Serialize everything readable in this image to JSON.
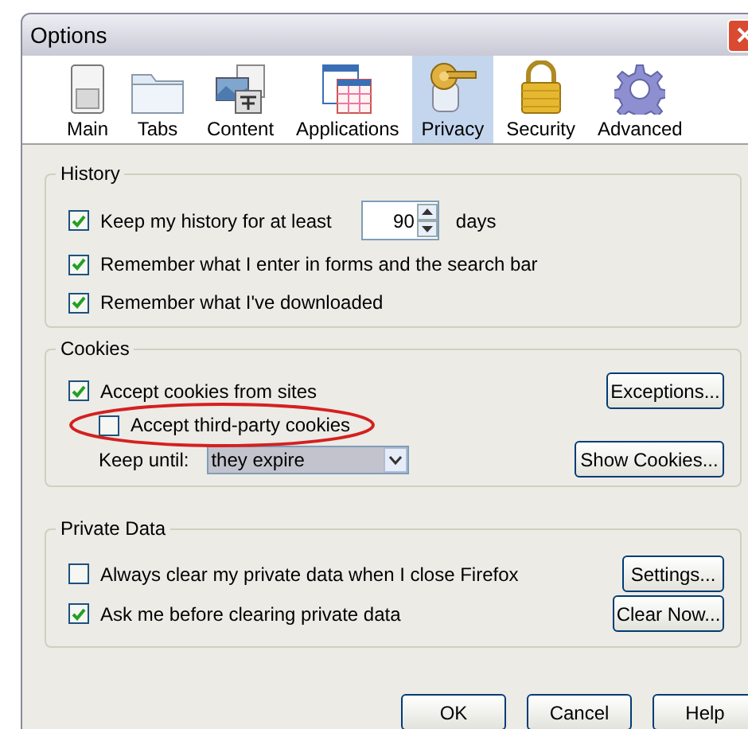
{
  "window": {
    "title": "Options"
  },
  "tabs": [
    {
      "label": "Main",
      "selected": false
    },
    {
      "label": "Tabs",
      "selected": false
    },
    {
      "label": "Content",
      "selected": false
    },
    {
      "label": "Applications",
      "selected": false
    },
    {
      "label": "Privacy",
      "selected": true
    },
    {
      "label": "Security",
      "selected": false
    },
    {
      "label": "Advanced",
      "selected": false
    }
  ],
  "history": {
    "title": "History",
    "keep_history": {
      "label": "Keep my history for at least",
      "checked": true,
      "value": "90",
      "unit": "days"
    },
    "options": [
      {
        "label": "Remember what I enter in forms and the search bar",
        "checked": true
      },
      {
        "label": "Remember what I've downloaded",
        "checked": true
      }
    ]
  },
  "cookies": {
    "title": "Cookies",
    "accept": {
      "label": "Accept cookies from sites",
      "checked": true
    },
    "exceptions_button": "Exceptions...",
    "third_party": {
      "label": "Accept third-party cookies",
      "checked": false,
      "highlighted": true
    },
    "keep_until": {
      "label": "Keep until:",
      "value": "they expire"
    },
    "show_button": "Show Cookies..."
  },
  "private_data": {
    "title": "Private Data",
    "rows": [
      {
        "label": "Always clear my private data when I close Firefox",
        "checked": false,
        "button": "Settings..."
      },
      {
        "label": "Ask me before clearing private data",
        "checked": true,
        "button": "Clear Now..."
      }
    ]
  },
  "buttons": [
    "OK",
    "Cancel",
    "Help"
  ]
}
